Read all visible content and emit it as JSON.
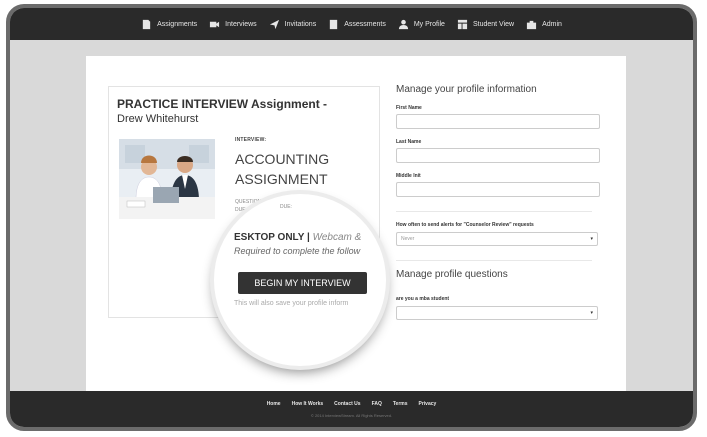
{
  "nav": {
    "items": [
      {
        "label": "Assignments",
        "icon": "file-icon"
      },
      {
        "label": "Interviews",
        "icon": "video-camera-icon"
      },
      {
        "label": "Invitations",
        "icon": "send-icon"
      },
      {
        "label": "Assessments",
        "icon": "document-icon"
      },
      {
        "label": "My Profile",
        "icon": "user-icon"
      },
      {
        "label": "Student View",
        "icon": "table-icon"
      },
      {
        "label": "Admin",
        "icon": "briefcase-icon"
      }
    ]
  },
  "card": {
    "title": "PRACTICE INTERVIEW Assignment -",
    "subtitle": "Drew Whitehurst",
    "interview_label": "INTERVIEW:",
    "interview_name": "ACCOUNTING ASSIGNMENT",
    "questions": "QUESTIONS: 1",
    "due": "DUE:"
  },
  "magnifier": {
    "desktop": "ESKTOP ONLY",
    "desktop_rest": "Webcam &",
    "required": "Required to complete the follow",
    "button": "BEGIN MY INTERVIEW",
    "note": "This will also save your profile inform"
  },
  "profile": {
    "title": "Manage your profile information",
    "fields": [
      {
        "label": "First Name",
        "value": ""
      },
      {
        "label": "Last Name",
        "value": ""
      },
      {
        "label": "Middle Init",
        "value": ""
      }
    ],
    "alerts_label": "How often to send alerts for \"Counselor Review\" requests",
    "alerts_value": "Never"
  },
  "questions": {
    "title": "Manage profile questions",
    "q1_label": "are you a mba student",
    "q1_value": ""
  },
  "footer": {
    "links": [
      "Home",
      "How It Works",
      "Contact Us",
      "FAQ",
      "Terms",
      "Privacy"
    ],
    "copyright": "© 2014 InterviewStream. All Rights Reserved."
  }
}
